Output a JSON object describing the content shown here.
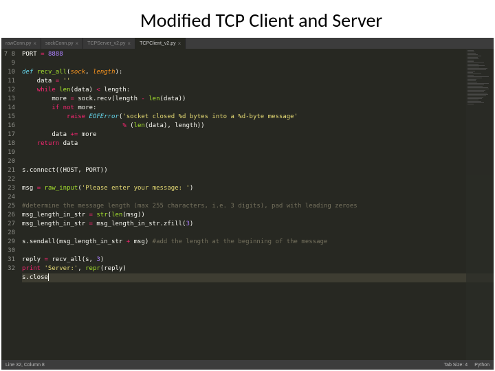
{
  "title": "Modified TCP Client and Server",
  "tabs": [
    {
      "label": "rawConn.py",
      "active": false
    },
    {
      "label": "sockConn.py",
      "active": false
    },
    {
      "label": "TCPServer_v2.py",
      "active": false
    },
    {
      "label": "TCPClient_v2.py",
      "active": true
    }
  ],
  "gutter_start": 7,
  "gutter_end": 32,
  "code_lines": [
    {
      "n": 7,
      "tokens": [
        [
          "var",
          "PORT "
        ],
        [
          "op",
          "= "
        ],
        [
          "num",
          "8888"
        ]
      ]
    },
    {
      "n": 8,
      "tokens": []
    },
    {
      "n": 9,
      "tokens": [
        [
          "kw2",
          "def "
        ],
        [
          "fn",
          "recv_all"
        ],
        [
          "var",
          "("
        ],
        [
          "par",
          "sock"
        ],
        [
          "var",
          ", "
        ],
        [
          "par",
          "length"
        ],
        [
          "var",
          "):"
        ]
      ]
    },
    {
      "n": 10,
      "tokens": [
        [
          "var",
          "    data "
        ],
        [
          "op",
          "= "
        ],
        [
          "str",
          "''"
        ]
      ]
    },
    {
      "n": 11,
      "tokens": [
        [
          "var",
          "    "
        ],
        [
          "kw",
          "while "
        ],
        [
          "fn",
          "len"
        ],
        [
          "var",
          "(data) "
        ],
        [
          "op",
          "< "
        ],
        [
          "var",
          "length:"
        ]
      ]
    },
    {
      "n": 12,
      "tokens": [
        [
          "var",
          "        more "
        ],
        [
          "op",
          "= "
        ],
        [
          "var",
          "sock.recv(length "
        ],
        [
          "op",
          "- "
        ],
        [
          "fn",
          "len"
        ],
        [
          "var",
          "(data))"
        ]
      ]
    },
    {
      "n": 13,
      "tokens": [
        [
          "var",
          "        "
        ],
        [
          "kw",
          "if "
        ],
        [
          "op",
          "not "
        ],
        [
          "var",
          "more:"
        ]
      ]
    },
    {
      "n": 14,
      "tokens": [
        [
          "var",
          "            "
        ],
        [
          "kw",
          "raise "
        ],
        [
          "err",
          "EOFError"
        ],
        [
          "var",
          "("
        ],
        [
          "str",
          "'socket closed %d bytes into a %d-byte message'"
        ]
      ]
    },
    {
      "n": 15,
      "tokens": [
        [
          "var",
          "                           "
        ],
        [
          "op",
          "% "
        ],
        [
          "var",
          "("
        ],
        [
          "fn",
          "len"
        ],
        [
          "var",
          "(data), length))"
        ]
      ]
    },
    {
      "n": 16,
      "tokens": [
        [
          "var",
          "        data "
        ],
        [
          "op",
          "+= "
        ],
        [
          "var",
          "more"
        ]
      ]
    },
    {
      "n": 17,
      "tokens": [
        [
          "var",
          "    "
        ],
        [
          "kw",
          "return "
        ],
        [
          "var",
          "data"
        ]
      ]
    },
    {
      "n": 18,
      "tokens": []
    },
    {
      "n": 19,
      "tokens": []
    },
    {
      "n": 20,
      "tokens": [
        [
          "var",
          "s.connect((HOST, PORT))"
        ]
      ]
    },
    {
      "n": 21,
      "tokens": []
    },
    {
      "n": 22,
      "tokens": [
        [
          "var",
          "msg "
        ],
        [
          "op",
          "= "
        ],
        [
          "fn",
          "raw_input"
        ],
        [
          "var",
          "("
        ],
        [
          "str",
          "'Please enter your message: '"
        ],
        [
          "var",
          ")"
        ]
      ]
    },
    {
      "n": 23,
      "tokens": []
    },
    {
      "n": 24,
      "tokens": [
        [
          "cmt",
          "#determine the message length (max 255 characters, i.e. 3 digits), pad with leading zeroes"
        ]
      ]
    },
    {
      "n": 25,
      "tokens": [
        [
          "var",
          "msg_length_in_str "
        ],
        [
          "op",
          "= "
        ],
        [
          "fn",
          "str"
        ],
        [
          "var",
          "("
        ],
        [
          "fn",
          "len"
        ],
        [
          "var",
          "(msg))"
        ]
      ]
    },
    {
      "n": 26,
      "tokens": [
        [
          "var",
          "msg_length_in_str "
        ],
        [
          "op",
          "= "
        ],
        [
          "var",
          "msg_length_in_str.zfill("
        ],
        [
          "num",
          "3"
        ],
        [
          "var",
          ")"
        ]
      ]
    },
    {
      "n": 27,
      "tokens": []
    },
    {
      "n": 28,
      "tokens": [
        [
          "var",
          "s.sendall(msg_length_in_str "
        ],
        [
          "op",
          "+ "
        ],
        [
          "var",
          "msg) "
        ],
        [
          "cmt",
          "#add the length at the beginning of the message"
        ]
      ]
    },
    {
      "n": 29,
      "tokens": []
    },
    {
      "n": 30,
      "tokens": [
        [
          "var",
          "reply "
        ],
        [
          "op",
          "= "
        ],
        [
          "var",
          "recv_all(s, "
        ],
        [
          "num",
          "3"
        ],
        [
          "var",
          ")"
        ]
      ]
    },
    {
      "n": 31,
      "tokens": [
        [
          "kw",
          "print "
        ],
        [
          "str",
          "'Server:'"
        ],
        [
          "var",
          ", "
        ],
        [
          "fn",
          "repr"
        ],
        [
          "var",
          "(reply)"
        ]
      ]
    },
    {
      "n": 32,
      "tokens": [
        [
          "var",
          "s.close"
        ]
      ],
      "cursor": true
    }
  ],
  "status": {
    "left": "Line 32, Column 8",
    "right_items": [
      "Tab Size: 4",
      "Python"
    ]
  }
}
